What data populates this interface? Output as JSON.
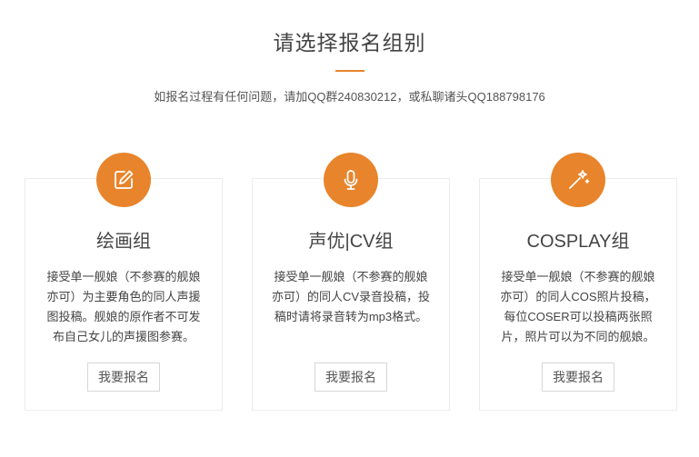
{
  "header": {
    "title": "请选择报名组别",
    "subtitle": "如报名过程有任何问题，请加QQ群240830212，或私聊诸头QQ188798176",
    "accent_color": "#e8842b"
  },
  "cards": [
    {
      "icon": "edit-icon",
      "title": "绘画组",
      "description": "接受单一舰娘（不参赛的舰娘亦可）为主要角色的同人声援图投稿。舰娘的原作者不可发布自己女儿的声援图参赛。",
      "button_label": "我要报名"
    },
    {
      "icon": "microphone-icon",
      "title": "声优|CV组",
      "description": "接受单一舰娘（不参赛的舰娘亦可）的同人CV录音投稿，投稿时请将录音转为mp3格式。",
      "button_label": "我要报名"
    },
    {
      "icon": "magic-wand-icon",
      "title": "COSPLAY组",
      "description": "接受单一舰娘（不参赛的舰娘亦可）的同人COS照片投稿，每位COSER可以投稿两张照片，照片可以为不同的舰娘。",
      "button_label": "我要报名"
    }
  ]
}
